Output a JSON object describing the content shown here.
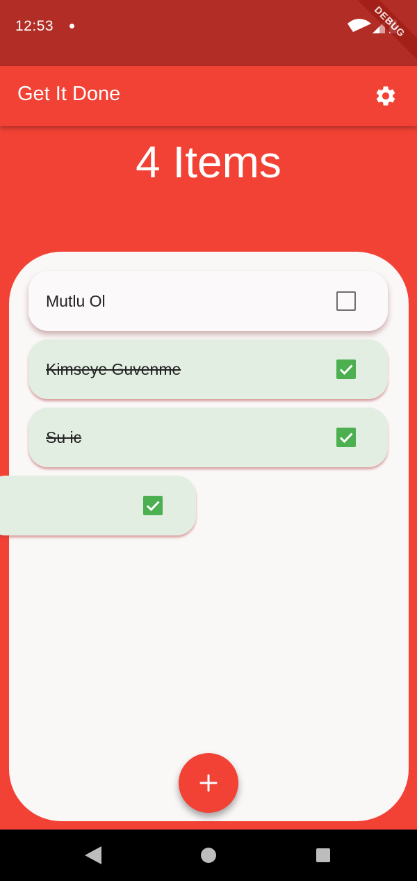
{
  "status_bar": {
    "time": "12:53",
    "banner": "DEBUG"
  },
  "app_bar": {
    "title": "Get It Done"
  },
  "summary": {
    "count_text": "4 Items"
  },
  "tasks": [
    {
      "label": "Mutlu Ol",
      "done": false
    },
    {
      "label": "Kimseye Guvenme",
      "done": true
    },
    {
      "label": "Su ic",
      "done": true
    },
    {
      "label": "",
      "done": true
    }
  ],
  "icons": {
    "settings": "gear-icon",
    "add": "plus-icon",
    "check": "check-icon",
    "nav_back": "back-triangle-icon",
    "nav_home": "home-circle-icon",
    "nav_recents": "recents-square-icon"
  },
  "colors": {
    "primary": "#F24236",
    "status_bar": "#B22D25",
    "panel": "#FAF7F7",
    "done_card": "#E3EEE3",
    "check": "#4CAF50"
  }
}
